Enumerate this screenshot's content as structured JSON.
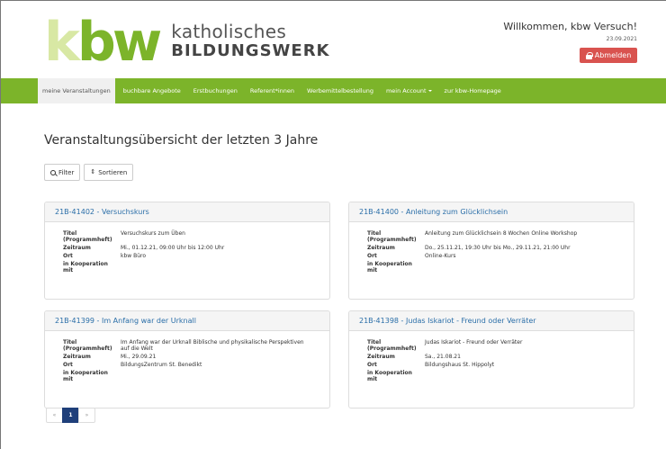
{
  "logo": {
    "mark_k": "k",
    "mark_bw": "bw",
    "line1": "katholisches",
    "line2": "BILDUNGSWERK"
  },
  "header": {
    "welcome": "Willkommen, kbw Versuch!",
    "date": "23.09.2021",
    "logout_label": "Abmelden"
  },
  "nav": {
    "items": [
      {
        "label": "meine Veranstaltungen"
      },
      {
        "label": "buchbare Angebote"
      },
      {
        "label": "Erstbuchungen"
      },
      {
        "label": "Referent*innen"
      },
      {
        "label": "Werbemittelbestellung"
      },
      {
        "label": "mein Account"
      },
      {
        "label": "zur kbw-Homepage"
      }
    ]
  },
  "main": {
    "title": "Veranstaltungsübersicht der letzten 3 Jahre",
    "filter_label": "Filter",
    "sort_label": "Sortieren"
  },
  "labels": {
    "titel": "Titel",
    "programmheft": "(Programmheft)",
    "zeitraum": "Zeitraum",
    "ort": "Ort",
    "kooperation1": "in Kooperation",
    "kooperation2": "mit"
  },
  "events": [
    {
      "heading": "21B-41402 - Versuchskurs",
      "title": "Versuchskurs zum Üben",
      "period": "Mi., 01.12.21, 09:00 Uhr bis 12:00 Uhr",
      "place": "kbw Büro",
      "cooperation": ""
    },
    {
      "heading": "21B-41400 - Anleitung zum Glücklichsein",
      "title": "Anleitung zum Glücklichsein 8 Wochen Online Workshop",
      "period": "Do., 25.11.21, 19:30 Uhr bis Mo., 29.11.21, 21:00 Uhr",
      "place": "Online-Kurs",
      "cooperation": ""
    },
    {
      "heading": "21B-41399 - Im Anfang war der Urknall",
      "title": "Im Anfang war der Urknall Biblische und physikalische Perspektiven auf die Welt",
      "period": "Mi., 29.09.21",
      "place": "BildungsZentrum St. Benedikt",
      "cooperation": ""
    },
    {
      "heading": "21B-41398 - Judas Iskariot - Freund oder Verräter",
      "title": "Judas Iskariot - Freund oder Verräter",
      "period": "Sa., 21.08.21",
      "place": "Bildungshaus St. Hippolyt",
      "cooperation": ""
    }
  ],
  "pagination": {
    "prev": "«",
    "current": "1",
    "next": "»"
  },
  "colors": {
    "brand_green": "#7cb42a",
    "logout_red": "#d9534f",
    "link_blue": "#2a6ea8",
    "active_page": "#1f3f7a"
  }
}
